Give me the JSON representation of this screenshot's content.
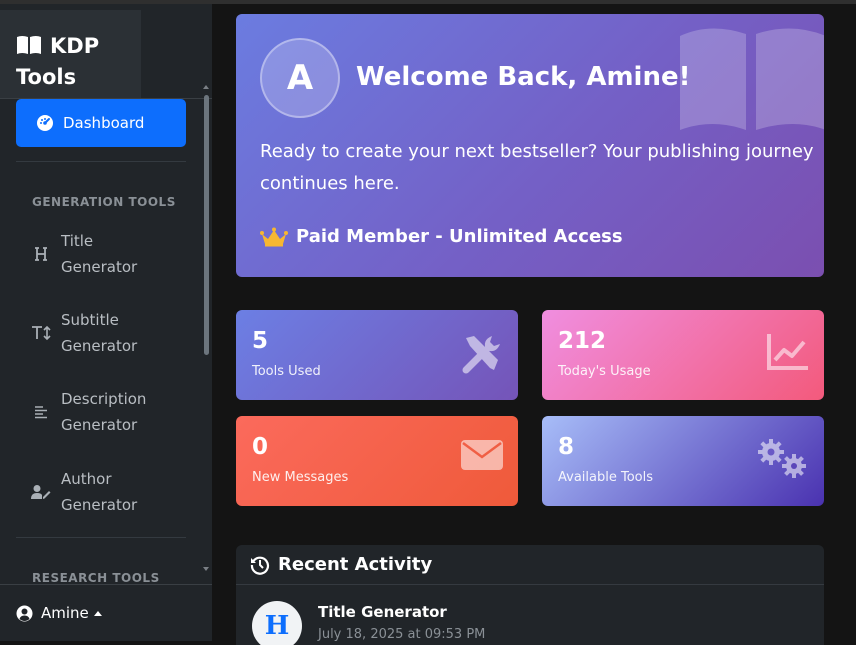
{
  "sidebar": {
    "brand_line1": "KDP",
    "brand_line2": "Tools",
    "active_item": "Dashboard",
    "section_generation": "GENERATION TOOLS",
    "items": [
      {
        "line1": "Title",
        "line2": "Generator",
        "icon": "heading-icon"
      },
      {
        "line1": "Subtitle",
        "line2": "Generator",
        "icon": "text-height-icon"
      },
      {
        "line1": "Description",
        "line2": "Generator",
        "icon": "align-left-icon"
      },
      {
        "line1": "Author",
        "line2": "Generator",
        "icon": "user-pen-icon"
      }
    ],
    "section_research": "RESEARCH TOOLS",
    "user_name": "Amine"
  },
  "welcome": {
    "avatar_letter": "A",
    "title": "Welcome Back, Amine!",
    "text": "Ready to create your next bestseller? Your publishing journey continues here.",
    "membership": "Paid Member - Unlimited Access"
  },
  "stats": [
    {
      "value": "5",
      "label": "Tools Used",
      "icon": "tools-icon"
    },
    {
      "value": "212",
      "label": "Today's Usage",
      "icon": "chart-line-icon"
    },
    {
      "value": "0",
      "label": "New Messages",
      "icon": "envelope-icon"
    },
    {
      "value": "8",
      "label": "Available Tools",
      "icon": "cogs-icon"
    }
  ],
  "activity": {
    "title": "Recent Activity",
    "items": [
      {
        "avatar_letter": "H",
        "title": "Title Generator",
        "time": "July 18, 2025 at 09:53 PM"
      }
    ]
  },
  "colors": {
    "primary": "#0d6efd",
    "sidebar_bg": "#212529",
    "page_bg": "#141414"
  }
}
